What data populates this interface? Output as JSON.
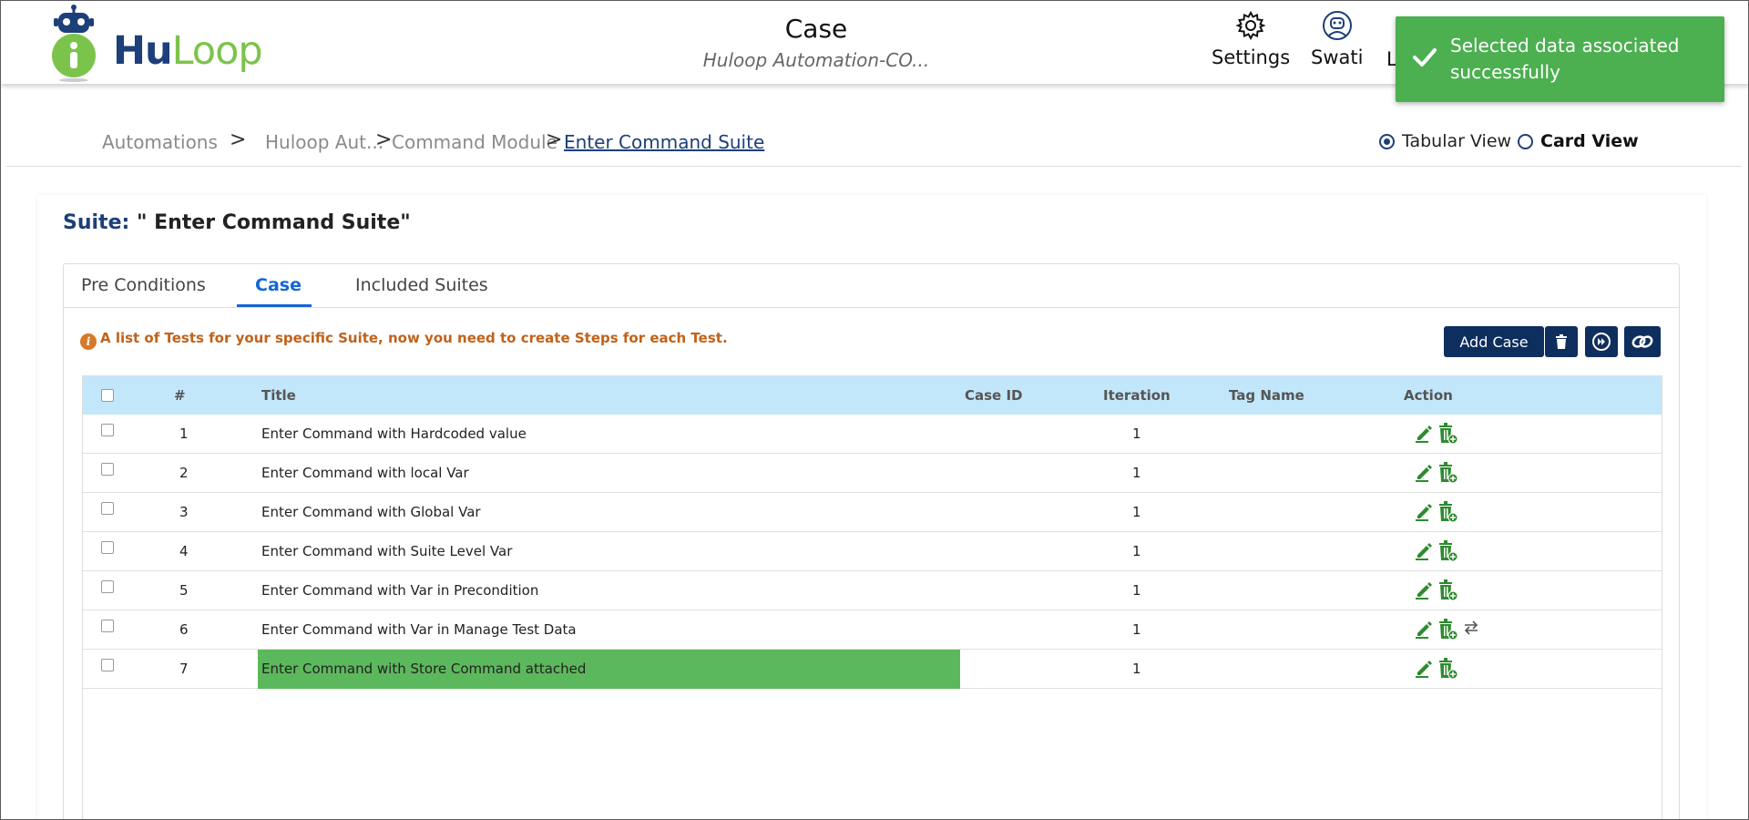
{
  "app": {
    "logo_hu": "Hu",
    "logo_loop": "Loop"
  },
  "header": {
    "title": "Case",
    "subtitle": "Huloop Automation-CO...",
    "settings_label": "Settings",
    "user_label": "Swati",
    "partial_label": "L"
  },
  "toast": {
    "message": "Selected data associated successfully",
    "color": "#4caf50"
  },
  "breadcrumb": {
    "items": [
      "Automations",
      "Huloop Aut...",
      "Command Module",
      "Enter Command Suite"
    ],
    "separator": ">"
  },
  "view": {
    "tabular_label": "Tabular View",
    "card_label": "Card View",
    "selected": "tabular"
  },
  "suite": {
    "label": "Suite:",
    "name": "\" Enter Command Suite\""
  },
  "tabs": [
    {
      "label": "Pre Conditions"
    },
    {
      "label": "Case",
      "active": true
    },
    {
      "label": "Included Suites"
    }
  ],
  "info": {
    "message": "A list of Tests for your specific Suite, now you need to create Steps for each Test."
  },
  "toolbar": {
    "add_case_label": "Add Case"
  },
  "table": {
    "columns": [
      "#",
      "Title",
      "Case ID",
      "Iteration",
      "Tag Name",
      "Action"
    ],
    "rows": [
      {
        "num": "1",
        "title": "Enter Command with Hardcoded value",
        "case_id": "",
        "iteration": "1",
        "tag": ""
      },
      {
        "num": "2",
        "title": "Enter Command with local Var",
        "case_id": "",
        "iteration": "1",
        "tag": ""
      },
      {
        "num": "3",
        "title": "Enter Command with Global Var",
        "case_id": "",
        "iteration": "1",
        "tag": ""
      },
      {
        "num": "4",
        "title": "Enter Command with Suite Level Var",
        "case_id": "",
        "iteration": "1",
        "tag": ""
      },
      {
        "num": "5",
        "title": "Enter Command with Var in Precondition",
        "case_id": "",
        "iteration": "1",
        "tag": ""
      },
      {
        "num": "6",
        "title": "Enter Command with Var in Manage Test Data",
        "case_id": "",
        "iteration": "1",
        "tag": "",
        "has_swap": true
      },
      {
        "num": "7",
        "title": "Enter Command with Store Command attached",
        "case_id": "",
        "iteration": "1",
        "tag": "",
        "highlighted": true
      }
    ]
  },
  "colors": {
    "brand_navy": "#1d3f7a",
    "brand_green": "#7cc34c",
    "header_row": "#c3e7fa",
    "highlight": "#5cb85c",
    "action_icon": "#2e8b2e"
  }
}
